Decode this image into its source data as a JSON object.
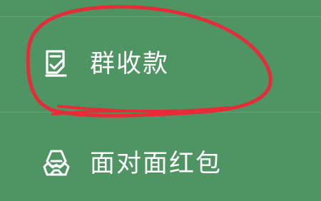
{
  "menu": {
    "items": [
      {
        "label": "群收款",
        "icon": "check-document-icon"
      },
      {
        "label": "面对面红包",
        "icon": "red-packet-icon"
      }
    ]
  },
  "colors": {
    "background": "#4f9463",
    "text": "#ffffff",
    "annotation": "#e52d3a"
  }
}
